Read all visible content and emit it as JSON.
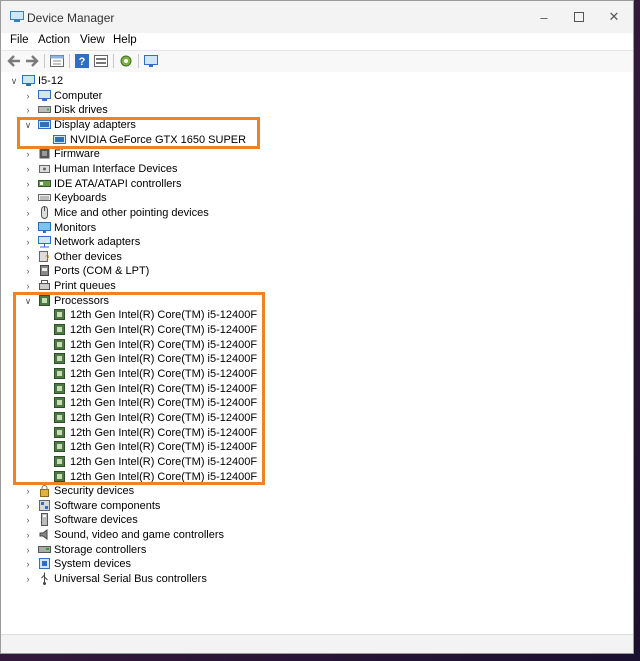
{
  "window": {
    "title": "Device Manager"
  },
  "menu": [
    "File",
    "Action",
    "View",
    "Help"
  ],
  "toolbar": {
    "buttons": [
      "back-arrow-icon",
      "forward-arrow-icon",
      "properties-icon",
      "help-icon",
      "update-driver-icon",
      "scan-hardware-icon",
      "monitor-icon"
    ]
  },
  "tree": {
    "root": "I5-12",
    "categories": [
      {
        "label": "Computer",
        "icon": "computer-icon"
      },
      {
        "label": "Disk drives",
        "icon": "disk-icon"
      },
      {
        "label": "Display adapters",
        "icon": "display-adapter-icon",
        "expanded": true,
        "children": [
          "NVIDIA GeForce GTX 1650 SUPER"
        ]
      },
      {
        "label": "Firmware",
        "icon": "firmware-icon"
      },
      {
        "label": "Human Interface Devices",
        "icon": "hid-icon"
      },
      {
        "label": "IDE ATA/ATAPI controllers",
        "icon": "ide-icon"
      },
      {
        "label": "Keyboards",
        "icon": "keyboard-icon"
      },
      {
        "label": "Mice and other pointing devices",
        "icon": "mouse-icon"
      },
      {
        "label": "Monitors",
        "icon": "monitor-icon"
      },
      {
        "label": "Network adapters",
        "icon": "network-icon"
      },
      {
        "label": "Other devices",
        "icon": "other-devices-icon"
      },
      {
        "label": "Ports (COM & LPT)",
        "icon": "port-icon"
      },
      {
        "label": "Print queues",
        "icon": "printer-icon"
      },
      {
        "label": "Processors",
        "icon": "processor-icon",
        "expanded": true,
        "children": [
          "12th Gen Intel(R) Core(TM) i5-12400F",
          "12th Gen Intel(R) Core(TM) i5-12400F",
          "12th Gen Intel(R) Core(TM) i5-12400F",
          "12th Gen Intel(R) Core(TM) i5-12400F",
          "12th Gen Intel(R) Core(TM) i5-12400F",
          "12th Gen Intel(R) Core(TM) i5-12400F",
          "12th Gen Intel(R) Core(TM) i5-12400F",
          "12th Gen Intel(R) Core(TM) i5-12400F",
          "12th Gen Intel(R) Core(TM) i5-12400F",
          "12th Gen Intel(R) Core(TM) i5-12400F",
          "12th Gen Intel(R) Core(TM) i5-12400F",
          "12th Gen Intel(R) Core(TM) i5-12400F"
        ]
      },
      {
        "label": "Security devices",
        "icon": "security-icon"
      },
      {
        "label": "Software components",
        "icon": "software-component-icon"
      },
      {
        "label": "Software devices",
        "icon": "software-device-icon"
      },
      {
        "label": "Sound, video and game controllers",
        "icon": "sound-icon"
      },
      {
        "label": "Storage controllers",
        "icon": "storage-icon"
      },
      {
        "label": "System devices",
        "icon": "system-icon"
      },
      {
        "label": "Universal Serial Bus controllers",
        "icon": "usb-icon"
      }
    ]
  },
  "colors": {
    "highlight": "#f08226",
    "accent": "#0067c0",
    "processor": "#4a7a42"
  }
}
